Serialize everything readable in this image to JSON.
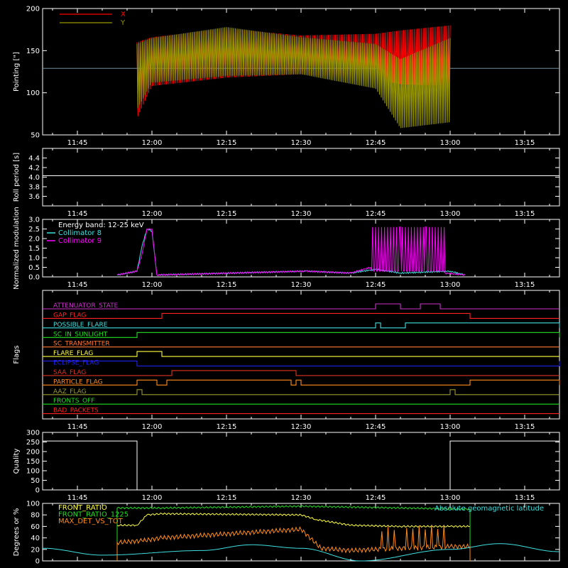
{
  "colors": {
    "background": "#000000",
    "axis": "#ffffff",
    "x_red": "#ff0000",
    "y_olive": "#9a9a00",
    "cyan": "#3fdfdf",
    "magenta": "#ff00ff",
    "white": "#ffffff",
    "yellow": "#ffff40",
    "green": "#22dd22",
    "orange": "#ff8c1a",
    "blue": "#2222ff",
    "purple": "#cc33cc",
    "brownred": "#dd3322",
    "olive": "#999933"
  },
  "time_axis": {
    "min": "11:38",
    "max": "13:22",
    "tick_labels": [
      "11:45",
      "12:00",
      "12:15",
      "12:30",
      "12:45",
      "13:00",
      "13:15"
    ],
    "tick_minutes": [
      705,
      720,
      735,
      750,
      765,
      780,
      795
    ]
  },
  "chart_data": [
    {
      "id": "pointing",
      "type": "line",
      "ylabel": "Pointing [\"]",
      "ylim": [
        50,
        200
      ],
      "yticks": [
        "50",
        "100",
        "150",
        "200"
      ],
      "reference_line": 129,
      "legend": [
        {
          "name": "X",
          "color": "#ff0000"
        },
        {
          "name": "Y",
          "color": "#9a9a00"
        }
      ],
      "series": [
        {
          "name": "X",
          "x": [
            "11:57",
            "12:00",
            "12:15",
            "12:30",
            "12:45",
            "12:50",
            "13:00"
          ],
          "y_min": [
            70,
            108,
            118,
            122,
            116,
            110,
            108
          ],
          "y_max": [
            160,
            166,
            176,
            168,
            170,
            174,
            180
          ]
        },
        {
          "name": "Y",
          "x": [
            "11:57",
            "12:00",
            "12:15",
            "12:30",
            "12:45",
            "12:50",
            "13:00"
          ],
          "y_min": [
            80,
            112,
            120,
            122,
            105,
            58,
            65
          ],
          "y_max": [
            158,
            165,
            178,
            166,
            158,
            140,
            165
          ]
        }
      ]
    },
    {
      "id": "roll",
      "type": "line",
      "ylabel": "Roll period [s]",
      "ylim": [
        3.4,
        4.6
      ],
      "yticks": [
        "3.6",
        "3.8",
        "4.0",
        "4.2",
        "4.4"
      ],
      "series": [
        {
          "name": "",
          "x": [
            "11:38",
            "13:22"
          ],
          "y": [
            4.03,
            4.03
          ]
        }
      ]
    },
    {
      "id": "modulation",
      "type": "line",
      "ylabel": "Normalized modulation",
      "ylim": [
        0,
        3.0
      ],
      "yticks": [
        "0.0",
        "0.5",
        "1.0",
        "1.5",
        "2.0",
        "2.5",
        "3.0"
      ],
      "legend": [
        {
          "name": "Energy band: 12-25 keV",
          "color": "#ffffff"
        },
        {
          "name": "Collimator 8",
          "color": "#3fdfdf"
        },
        {
          "name": "Collimator 9",
          "color": "#ff00ff"
        }
      ],
      "series": [
        {
          "name": "Collimator 8",
          "x": [
            "11:53",
            "11:57",
            "11:58",
            "11:59",
            "12:00",
            "12:01",
            "12:31",
            "12:40",
            "12:45",
            "12:50",
            "13:00",
            "13:03"
          ],
          "y": [
            0.1,
            0.3,
            1.6,
            2.5,
            2.4,
            0.1,
            0.3,
            0.2,
            0.4,
            0.2,
            0.3,
            0.1
          ]
        },
        {
          "name": "Collimator 9",
          "x": [
            "11:53",
            "11:57",
            "11:58",
            "11:59",
            "12:00",
            "12:01",
            "12:31",
            "12:40",
            "12:44",
            "12:45",
            "12:50",
            "12:55",
            "12:59",
            "13:03"
          ],
          "y": [
            0.1,
            0.3,
            1.2,
            2.5,
            2.5,
            0.1,
            0.3,
            0.2,
            0.5,
            2.6,
            2.6,
            2.6,
            0.2,
            0.1
          ]
        }
      ]
    },
    {
      "id": "flags",
      "type": "line",
      "ylabel": "Flags",
      "series": [
        {
          "name": "ATTENUATOR_STATE",
          "color": "#cc33cc",
          "x": [
            "11:38",
            "12:44",
            "12:45",
            "12:49",
            "12:50",
            "12:53",
            "12:54",
            "12:57",
            "12:58",
            "13:22"
          ],
          "y": [
            0,
            0,
            1,
            1,
            0,
            0,
            1,
            1,
            0,
            0
          ]
        },
        {
          "name": "GAP_FLAG",
          "color": "#ff2222",
          "x": [
            "11:38",
            "11:53",
            "12:02",
            "12:30",
            "13:04",
            "13:22"
          ],
          "y": [
            0,
            0,
            1,
            1,
            0,
            0
          ]
        },
        {
          "name": "POSSIBLE_FLARE",
          "color": "#3fdfdf",
          "x": [
            "11:38",
            "12:30",
            "12:45",
            "12:46",
            "12:50",
            "12:51",
            "13:22"
          ],
          "y": [
            0,
            0,
            1,
            0,
            0,
            1,
            0
          ]
        },
        {
          "name": "SC_IN_SUNLIGHT",
          "color": "#22dd22",
          "x": [
            "11:38",
            "11:57",
            "13:00",
            "13:22"
          ],
          "y": [
            0,
            1,
            1,
            0
          ]
        },
        {
          "name": "SC_TRANSMITTER",
          "color": "#ff7733",
          "x": [
            "11:38",
            "13:22"
          ],
          "y": [
            0,
            0
          ]
        },
        {
          "name": "FLARE_FLAG",
          "color": "#ffff40",
          "x": [
            "11:38",
            "11:57",
            "12:02",
            "13:22"
          ],
          "y": [
            0,
            1,
            0,
            0
          ]
        },
        {
          "name": "ECLIPSE_FLAG",
          "color": "#2222ff",
          "x": [
            "11:38",
            "11:57",
            "13:00",
            "13:22"
          ],
          "y": [
            1,
            0,
            0,
            1
          ]
        },
        {
          "name": "SAA_FLAG",
          "color": "#dd3322",
          "x": [
            "11:38",
            "12:04",
            "12:29",
            "13:22"
          ],
          "y": [
            0,
            1,
            0,
            0
          ]
        },
        {
          "name": "PARTICLE_FLAG",
          "color": "#ff8c1a",
          "x": [
            "11:38",
            "11:57",
            "12:01",
            "12:03",
            "12:28",
            "12:29",
            "12:30",
            "13:04",
            "13:22"
          ],
          "y": [
            0,
            1,
            0,
            1,
            0,
            1,
            0,
            1,
            0
          ]
        },
        {
          "name": "AAZ_FLAG",
          "color": "#999933",
          "x": [
            "11:38",
            "11:57",
            "11:58",
            "13:00",
            "13:01",
            "13:22"
          ],
          "y": [
            0,
            1,
            0,
            1,
            0,
            0
          ]
        },
        {
          "name": "FRONTS_OFF",
          "color": "#22dd22",
          "x": [
            "11:38",
            "13:22"
          ],
          "y": [
            0,
            0
          ]
        },
        {
          "name": "BAD_PACKETS",
          "color": "#ff2222",
          "x": [
            "11:38",
            "13:22"
          ],
          "y": [
            0,
            0
          ]
        }
      ]
    },
    {
      "id": "quality",
      "type": "line",
      "ylabel": "Quality",
      "ylim": [
        0,
        300
      ],
      "yticks": [
        "0",
        "50",
        "100",
        "150",
        "200",
        "250",
        "300"
      ],
      "series": [
        {
          "name": "",
          "x": [
            "11:38",
            "11:57",
            "11:57",
            "13:00",
            "13:00",
            "13:22"
          ],
          "y": [
            255,
            255,
            0,
            0,
            255,
            255
          ]
        }
      ]
    },
    {
      "id": "front_ratio",
      "type": "line",
      "ylabel": "Degrees or %",
      "ylim": [
        0,
        100
      ],
      "yticks": [
        "0",
        "20",
        "40",
        "60",
        "80",
        "100"
      ],
      "legend": [
        {
          "name": "FRONT_RATIO",
          "color": "#ffff40"
        },
        {
          "name": "FRONT_RATIO_1225",
          "color": "#22dd22"
        },
        {
          "name": "MAX_DET_VS_TOT",
          "color": "#ff8c1a"
        }
      ],
      "annotation": {
        "text": "Absolute geomagnetic latitude",
        "color": "#3fdfdf"
      },
      "series": [
        {
          "name": "FRONT_RATIO",
          "x": [
            "11:53",
            "11:57",
            "11:59",
            "12:02",
            "12:30",
            "12:33",
            "12:40",
            "12:50",
            "13:00",
            "13:04"
          ],
          "y": [
            62,
            62,
            80,
            82,
            80,
            72,
            62,
            60,
            60,
            60
          ]
        },
        {
          "name": "FRONT_RATIO_1225",
          "x": [
            "11:53",
            "12:02",
            "12:30",
            "13:04"
          ],
          "y": [
            92,
            92,
            95,
            90
          ]
        },
        {
          "name": "MAX_DET_VS_TOT",
          "x": [
            "11:53",
            "11:58",
            "12:02",
            "12:30",
            "12:34",
            "12:40",
            "12:50",
            "13:00",
            "13:04"
          ],
          "y": [
            32,
            35,
            40,
            55,
            22,
            18,
            22,
            25,
            25
          ]
        },
        {
          "name": "Absolute geomagnetic latitude",
          "x": [
            "11:38",
            "11:50",
            "12:10",
            "12:20",
            "12:30",
            "12:42",
            "13:00",
            "13:10",
            "13:22"
          ],
          "y": [
            22,
            10,
            18,
            28,
            22,
            0,
            20,
            30,
            16
          ]
        }
      ]
    }
  ]
}
